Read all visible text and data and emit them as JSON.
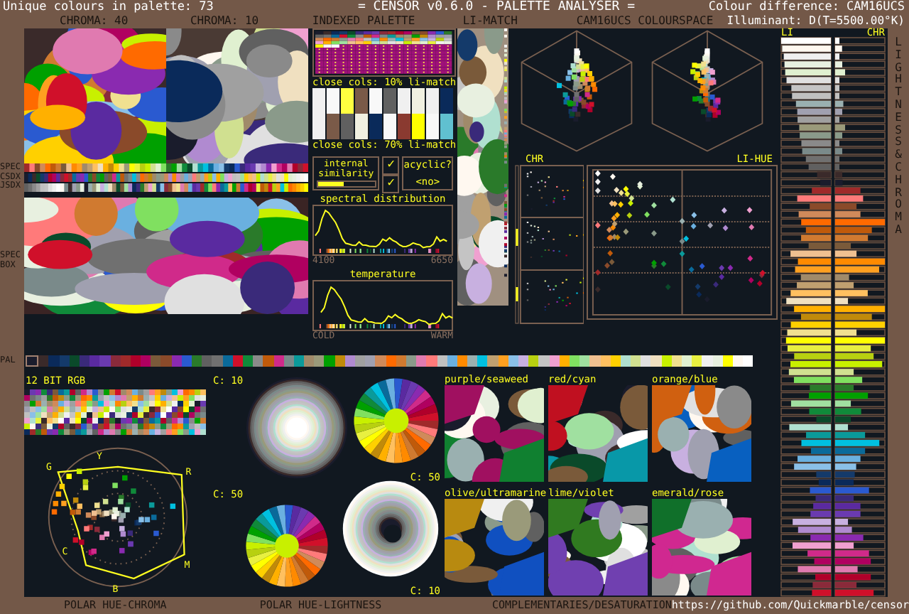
{
  "header": {
    "palette_count": "Unique colours in palette: 73",
    "title": "= CENSOR v0.6.0 - PALETTE ANALYSER =",
    "colour_difference": "Colour difference: CAM16UCS",
    "illuminant": "Illuminant: D(T=5500.00°K)"
  },
  "section_titles": [
    "CHROMA: 40",
    "CHROMA: 10",
    "INDEXED PALETTE",
    "LI-MATCH",
    "CAM16UCS COLOURSPACE"
  ],
  "side_labels": {
    "stripes": [
      "SPEC",
      "CSDX",
      "JSDX"
    ],
    "spec_box": [
      "SPEC",
      "BOX"
    ],
    "palette": "PAL"
  },
  "close_colours": [
    {
      "label": "close cols: 10% li-match",
      "swatches": [
        {
          "color": "#f0f0f0"
        },
        {
          "color": "#f8f8f8"
        },
        {
          "color": "#ffff40"
        },
        {
          "color": "#7a5a48"
        },
        {
          "color": "#f8f8f8"
        },
        {
          "color": "#606060"
        },
        {
          "color": "#f0f0f0"
        },
        {
          "color": "#f0f0e0"
        },
        {
          "color": "#f0f0f0"
        },
        {
          "color": "#0a2a5a"
        }
      ]
    },
    {
      "label": "close cols: 70% li-match",
      "swatches": [
        {
          "color": "#f0f0f0"
        },
        {
          "color": "#7a5a48"
        },
        {
          "color": "#606060"
        },
        {
          "color": "#f0f0e0"
        },
        {
          "color": "#0a2a5a"
        },
        {
          "color": "#f8f8f8"
        },
        {
          "color": "#8a3a30"
        },
        {
          "color": "#ffff00"
        },
        {
          "color": "#f8f8f8"
        },
        {
          "color": "#60c0d0"
        }
      ]
    }
  ],
  "internal_similarity": {
    "label": "internal similarity",
    "check": "✓",
    "level": 0.45
  },
  "second_check": "✓",
  "acyclic": {
    "label": "acyclic?",
    "value": "<no>"
  },
  "spectral": {
    "title": "spectral distribution",
    "min": "4100",
    "max": "6650"
  },
  "temperature": {
    "title": "temperature",
    "min": "COLD",
    "max": "WARM"
  },
  "plots": {
    "chroma_label": "CHR",
    "li_hue_label": "LI-HUE"
  },
  "bars": {
    "lightness_label": "LI",
    "chroma_label": "CHR",
    "side_title": "LIGHTNESS & CHROMA"
  },
  "palette": [
    {
      "color": "#1a1c2c",
      "selected": true
    },
    {
      "color": "#3a2a2a",
      "selected": false
    },
    {
      "color": "#0a2a5a",
      "selected": false
    },
    {
      "color": "#143a6a",
      "selected": false
    },
    {
      "color": "#0a4a2a",
      "selected": false
    },
    {
      "color": "#3a2a7a",
      "selected": false
    },
    {
      "color": "#5a2aa0",
      "selected": false
    },
    {
      "color": "#6a3ab0",
      "selected": false
    },
    {
      "color": "#8a2a3a",
      "selected": false
    },
    {
      "color": "#a02a2a",
      "selected": false
    },
    {
      "color": "#b0002a",
      "selected": false
    },
    {
      "color": "#b00060",
      "selected": false
    },
    {
      "color": "#7a5a3a",
      "selected": false
    },
    {
      "color": "#8a4a2a",
      "selected": false
    },
    {
      "color": "#8a2ab0",
      "selected": false
    },
    {
      "color": "#2a5ad0",
      "selected": false
    },
    {
      "color": "#2a7a2a",
      "selected": false
    },
    {
      "color": "#606060",
      "selected": false
    },
    {
      "color": "#707070",
      "selected": false
    },
    {
      "color": "#0a6a9a",
      "selected": false
    },
    {
      "color": "#d0102a",
      "selected": false
    },
    {
      "color": "#108a3a",
      "selected": false
    },
    {
      "color": "#8a8a8a",
      "selected": false
    },
    {
      "color": "#c05a0a",
      "selected": false
    },
    {
      "color": "#d02a8a",
      "selected": false
    },
    {
      "color": "#7a8a8a",
      "selected": false
    },
    {
      "color": "#0a9a9a",
      "selected": false
    },
    {
      "color": "#a08a6a",
      "selected": false
    },
    {
      "color": "#9a9a7a",
      "selected": false
    },
    {
      "color": "#00a000",
      "selected": false
    },
    {
      "color": "#c08a0a",
      "selected": false
    },
    {
      "color": "#b08ad0",
      "selected": false
    },
    {
      "color": "#a0a0a0",
      "selected": false
    },
    {
      "color": "#a0a0b0",
      "selected": false
    },
    {
      "color": "#d08a5a",
      "selected": false
    },
    {
      "color": "#ff6a00",
      "selected": false
    },
    {
      "color": "#d07a30",
      "selected": false
    },
    {
      "color": "#8a9a8a",
      "selected": false
    },
    {
      "color": "#e07ab0",
      "selected": false
    },
    {
      "color": "#ff7a7a",
      "selected": false
    },
    {
      "color": "#c0c0c0",
      "selected": false
    },
    {
      "color": "#6ab0e0",
      "selected": false
    },
    {
      "color": "#ff8a00",
      "selected": false
    },
    {
      "color": "#9ab0b0",
      "selected": false
    },
    {
      "color": "#00c0e0",
      "selected": false
    },
    {
      "color": "#c0a070",
      "selected": false
    },
    {
      "color": "#ffa020",
      "selected": false
    },
    {
      "color": "#8ac0e8",
      "selected": false
    },
    {
      "color": "#c8b0e0",
      "selected": false
    },
    {
      "color": "#b8d010",
      "selected": false
    },
    {
      "color": "#c4c4c4",
      "selected": false
    },
    {
      "color": "#f0a0d0",
      "selected": false
    },
    {
      "color": "#ffb000",
      "selected": false
    },
    {
      "color": "#80e060",
      "selected": false
    },
    {
      "color": "#a0e0a0",
      "selected": false
    },
    {
      "color": "#f0c090",
      "selected": false
    },
    {
      "color": "#ffc060",
      "selected": false
    },
    {
      "color": "#ffd000",
      "selected": false
    },
    {
      "color": "#b0e0d0",
      "selected": false
    },
    {
      "color": "#d0e090",
      "selected": false
    },
    {
      "color": "#e0e0e0",
      "selected": false
    },
    {
      "color": "#f0e0c0",
      "selected": false
    },
    {
      "color": "#c8f000",
      "selected": false
    },
    {
      "color": "#f0e090",
      "selected": false
    },
    {
      "color": "#e0f0d0",
      "selected": false
    },
    {
      "color": "#e8f040",
      "selected": false
    },
    {
      "color": "#f0f0f0",
      "selected": false
    },
    {
      "color": "#e8f0e0",
      "selected": false
    },
    {
      "color": "#ffff00",
      "selected": false
    },
    {
      "color": "#fff8f0",
      "selected": false
    },
    {
      "color": "#ffffff",
      "selected": false
    }
  ],
  "rgb_title": "12 BIT RGB",
  "hue_labels": [
    "G",
    "Y",
    "R",
    "C",
    "M",
    "B"
  ],
  "hue_lightness_labels": [
    "C: 10",
    "C: 50",
    "C: 50",
    "C: 10"
  ],
  "complementaries": [
    {
      "label": "purple/seaweed",
      "tones": [
        {
          "color": "#a01060"
        },
        {
          "color": "#108030"
        }
      ]
    },
    {
      "label": "red/cyan",
      "tones": [
        {
          "color": "#c01020"
        },
        {
          "color": "#0898a8"
        }
      ]
    },
    {
      "label": "orange/blue",
      "tones": [
        {
          "color": "#d06010"
        },
        {
          "color": "#0860c0"
        }
      ]
    },
    {
      "label": "olive/ultramarine",
      "tones": [
        {
          "color": "#b88a10"
        },
        {
          "color": "#1050c0"
        }
      ]
    },
    {
      "label": "lime/violet",
      "tones": [
        {
          "color": "#307a20"
        },
        {
          "color": "#7040b0"
        }
      ]
    },
    {
      "label": "emerald/rose",
      "tones": [
        {
          "color": "#10702a"
        },
        {
          "color": "#d02890"
        }
      ]
    }
  ],
  "footer": [
    "POLAR HUE-CHROMA",
    "POLAR HUE-LIGHTNESS",
    "COMPLEMENTARIES/DESATURATION"
  ],
  "url": "https://github.com/Quickmarble/censor"
}
